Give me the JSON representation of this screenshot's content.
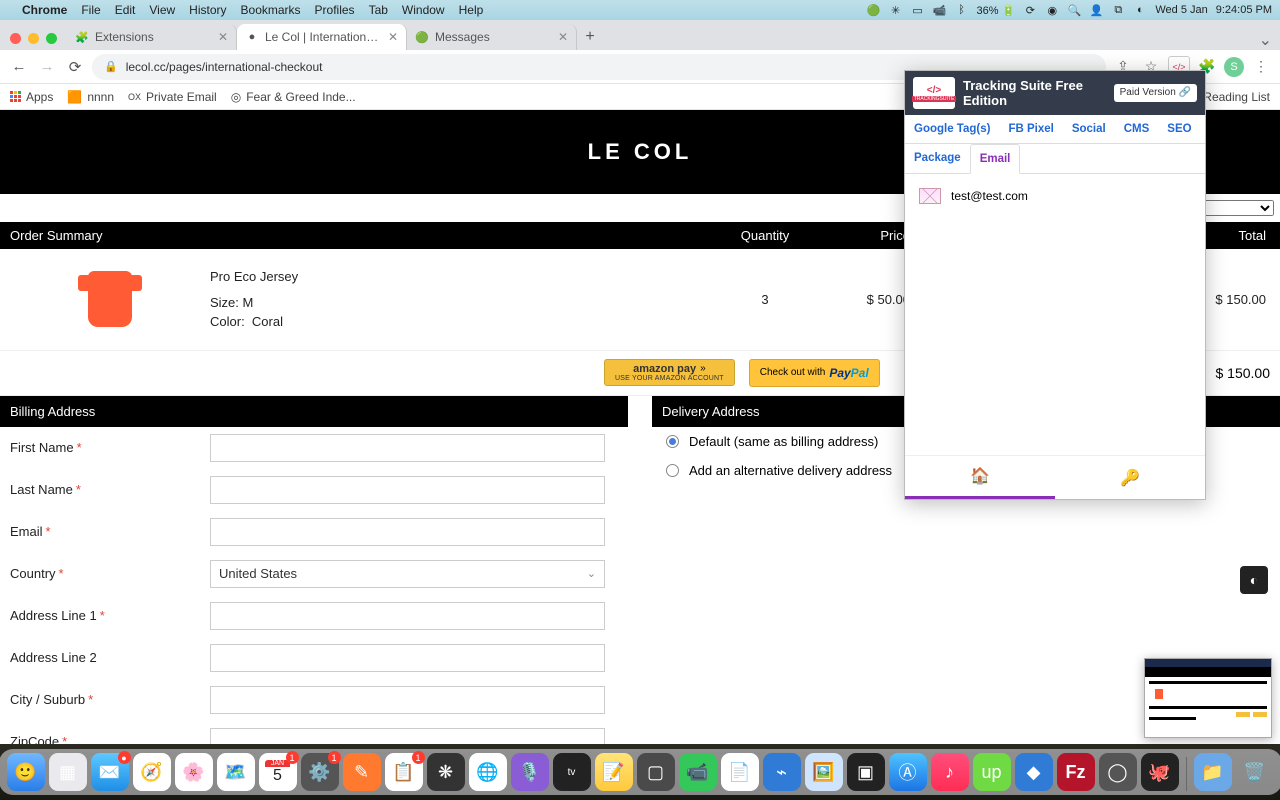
{
  "mac": {
    "app": "Chrome",
    "menus": [
      "File",
      "Edit",
      "View",
      "History",
      "Bookmarks",
      "Profiles",
      "Tab",
      "Window",
      "Help"
    ],
    "battery": "36%",
    "date": "Wed 5 Jan",
    "time": "9:24:05 PM"
  },
  "tabs": [
    {
      "title": "Extensions",
      "favicon": "🧩"
    },
    {
      "title": "Le Col | International Checkout",
      "favicon": "●",
      "active": true
    },
    {
      "title": "Messages",
      "favicon": "🟢"
    }
  ],
  "url": "lecol.cc/pages/international-checkout",
  "bookmarks": {
    "apps": "Apps",
    "items": [
      "nnnn",
      "Private Email",
      "Fear & Greed Inde..."
    ],
    "readinglist": "Reading List"
  },
  "brand": "LE COL",
  "order_summary": {
    "title": "Order Summary",
    "cols": {
      "qty": "Quantity",
      "price": "Price",
      "total": "Total"
    },
    "item": {
      "name": "Pro Eco Jersey",
      "size_label": "Size:",
      "size": "M",
      "color_label": "Color:",
      "color": "Coral",
      "qty": "3",
      "price": "$ 50.00",
      "line_total": "$ 150.00"
    },
    "amazon": {
      "top": "amazon pay",
      "sub": "USE YOUR AMAZON ACCOUNT"
    },
    "paypal": {
      "pre": "Check out with"
    },
    "grand_total": "$ 150.00"
  },
  "billing": {
    "title": "Billing Address",
    "fields": {
      "first": "First Name",
      "last": "Last Name",
      "email": "Email",
      "country": "Country",
      "country_val": "United States",
      "addr1": "Address Line 1",
      "addr2": "Address Line 2",
      "city": "City / Suburb",
      "zip": "ZipCode"
    }
  },
  "delivery": {
    "title": "Delivery Address",
    "opt1": "Default (same as billing address)",
    "opt2": "Add an alternative delivery address"
  },
  "ext": {
    "title": "Tracking Suite Free Edition",
    "paid": "Paid Version 🔗",
    "tabs": [
      "Google Tag(s)",
      "FB Pixel",
      "Social",
      "CMS",
      "SEO"
    ],
    "tabs2": [
      "Package",
      "Email"
    ],
    "active": "Email",
    "email": "test@test.com"
  }
}
